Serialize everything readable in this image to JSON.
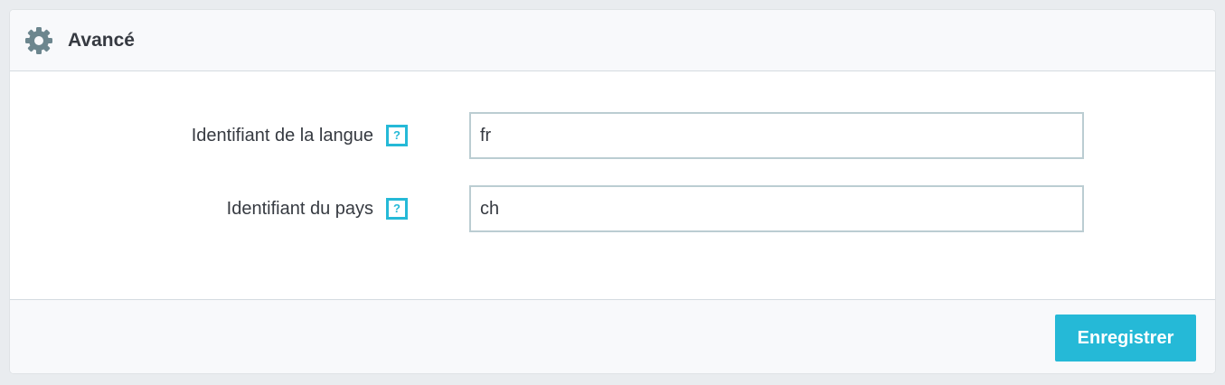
{
  "panel": {
    "title": "Avancé",
    "icon": "gear-icon"
  },
  "fields": [
    {
      "label": "Identifiant de la langue",
      "value": "fr",
      "help": "?"
    },
    {
      "label": "Identifiant du pays",
      "value": "ch",
      "help": "?"
    }
  ],
  "footer": {
    "save_label": "Enregistrer"
  },
  "colors": {
    "accent": "#25b9d7",
    "text": "#363a41",
    "icon": "#6c868e"
  }
}
